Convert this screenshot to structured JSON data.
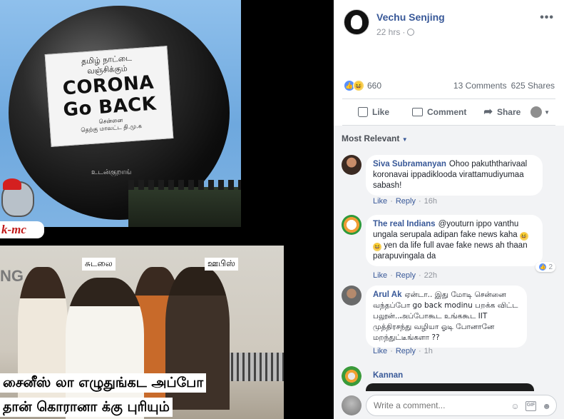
{
  "meme": {
    "sign_line1": "தமிழ் நாட்டை",
    "sign_line2": "வஞ்சிக்கும்",
    "sign_big1": "CORONA",
    "sign_big2": "Go BACK",
    "sign_small1": "சென்னை",
    "sign_small2": "தெற்கு மாவட்ட தி.மு.க",
    "balloon_text": "உடன்குறாங்",
    "sticker_label": "k-mc",
    "wall_text": "NG",
    "tag_left": "சுடலை",
    "tag_right": "ஊபிஸ்",
    "caption_line1": "சைனீஸ் லா எழுதுங்கட அப்போ",
    "caption_line2": "தான் கொரானா க்கு புரியும்"
  },
  "post": {
    "author": "Vechu Senjing",
    "time": "22 hrs",
    "time_sep": "·",
    "reaction_count": "660",
    "comments": "13 Comments",
    "shares": "625 Shares",
    "actions": {
      "like": "Like",
      "comment": "Comment",
      "share": "Share"
    }
  },
  "comments_section": {
    "sort_label": "Most Relevant",
    "items": [
      {
        "name": "Siva Subramanyan",
        "text": "Ohoo pakuththarivaal koronavai ippadiklooda virattamudiyumaa sabash!",
        "like": "Like",
        "reply": "Reply",
        "time": "16h"
      },
      {
        "name": "The real Indians",
        "text_a": "@youturn ippo vanthu ungala serupala adipan fake news kaha",
        "text_b": "yen da life full avae fake news ah thaan parapuvingala da",
        "like": "Like",
        "reply": "Reply",
        "time": "22h",
        "react_count": "2"
      },
      {
        "name": "Arul Ak",
        "text": "ஏன்டா.. இது மோடி சென்னை வந்தப்போ go back modinu பறக்க விட்ட பலூன்..அப்போகூட உங்ககூட IIT முத்திரசந்து வழியா ஓடி போனானே மறந்துட்டீங்களா ??",
        "like": "Like",
        "reply": "Reply",
        "time": "1h"
      },
      {
        "name": "Kannan"
      }
    ],
    "sep": "·",
    "write_placeholder": "Write a comment..."
  }
}
